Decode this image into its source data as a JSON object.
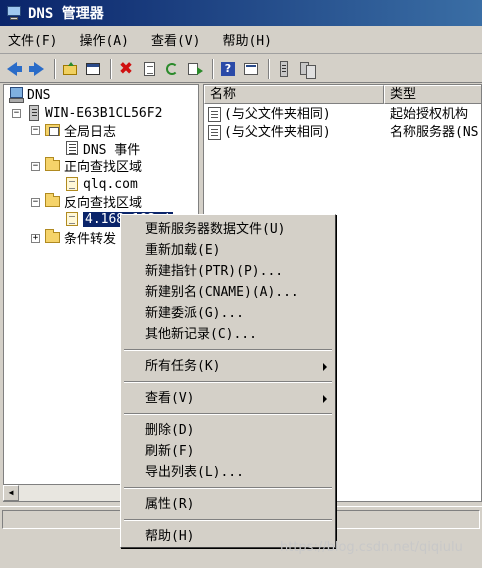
{
  "window": {
    "title": "DNS 管理器"
  },
  "menubar": {
    "items": [
      "文件(F)",
      "操作(A)",
      "查看(V)",
      "帮助(H)"
    ]
  },
  "toolbar": {
    "buttons": [
      "back-icon",
      "forward-icon",
      "up-folder-icon",
      "show-console-tree-icon",
      "delete-icon",
      "properties-doc-icon",
      "refresh-icon",
      "export-list-icon",
      "help-icon",
      "properties-icon",
      "server-icon",
      "servers-icon"
    ]
  },
  "tree": {
    "root": "DNS",
    "server": "WIN-E63B1CL56F2",
    "global_logs": "全局日志",
    "dns_events": "DNS 事件",
    "forward_zones": "正向查找区域",
    "forward_zone_item": "qlq.com",
    "reverse_zones": "反向查找区域",
    "reverse_zone_item": "4.168.192.i",
    "conditional": "条件转发"
  },
  "list": {
    "columns": [
      "名称",
      "类型"
    ],
    "rows": [
      {
        "name": "(与父文件夹相同)",
        "type": "起始授权机构"
      },
      {
        "name": "(与父文件夹相同)",
        "type": "名称服务器(NS"
      }
    ]
  },
  "context_menu": {
    "group1": [
      "更新服务器数据文件(U)",
      "重新加载(E)",
      "新建指针(PTR)(P)...",
      "新建别名(CNAME)(A)...",
      "新建委派(G)...",
      "其他新记录(C)..."
    ],
    "all_tasks": "所有任务(K)",
    "view": "查看(V)",
    "group3": [
      "删除(D)",
      "刷新(F)",
      "导出列表(L)..."
    ],
    "properties": "属性(R)",
    "help": "帮助(H)"
  },
  "watermark": "https://blog.csdn.net/qiqiulu",
  "colors": {
    "title_bar": "#0a246a",
    "selection": "#0a246a",
    "face": "#d4d0c8"
  }
}
